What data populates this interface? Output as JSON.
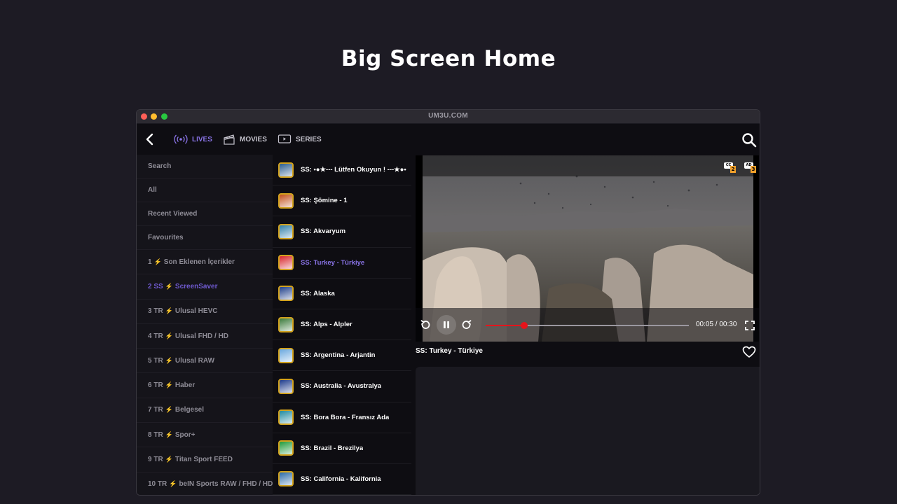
{
  "page": {
    "title": "Big Screen Home"
  },
  "window": {
    "url": "UM3U.COM"
  },
  "nav": {
    "lives": "LIVES",
    "movies": "MOVIES",
    "series": "SERIES"
  },
  "sidebar": {
    "items": [
      {
        "label": "Search"
      },
      {
        "label": "All"
      },
      {
        "label": "Recent Viewed"
      },
      {
        "label": "Favourites"
      }
    ],
    "categories": [
      {
        "num": "1",
        "prefix": "",
        "label": "Son Eklenen İçerikler"
      },
      {
        "num": "2 SS",
        "prefix": "",
        "label": "ScreenSaver"
      },
      {
        "num": "3 TR",
        "prefix": "",
        "label": "Ulusal HEVC"
      },
      {
        "num": "4 TR",
        "prefix": "",
        "label": "Ulusal FHD / HD"
      },
      {
        "num": "5 TR",
        "prefix": "",
        "label": "Ulusal RAW"
      },
      {
        "num": "6 TR",
        "prefix": "",
        "label": "Haber"
      },
      {
        "num": "7 TR",
        "prefix": "",
        "label": "Belgesel"
      },
      {
        "num": "8 TR",
        "prefix": "",
        "label": "Spor+"
      },
      {
        "num": "9 TR",
        "prefix": "",
        "label": "Titan Sport FEED"
      },
      {
        "num": "10 TR",
        "prefix": "",
        "label": "beIN Sports RAW / FHD / HD"
      }
    ]
  },
  "channels": [
    {
      "name": "SS: •●★--- Lütfen Okuyun ! ---★●•",
      "color": "#2b5d8f"
    },
    {
      "name": "SS: Şömine - 1",
      "color": "#c2501b"
    },
    {
      "name": "SS: Akvaryum",
      "color": "#2f7fa8"
    },
    {
      "name": "SS: Turkey - Türkiye",
      "color": "#d8252a"
    },
    {
      "name": "SS: Alaska",
      "color": "#1f3f8a"
    },
    {
      "name": "SS: Alps - Alpler",
      "color": "#3a7a3a"
    },
    {
      "name": "SS: Argentina - Arjantin",
      "color": "#6aa8de"
    },
    {
      "name": "SS: Australia - Avustralya",
      "color": "#1e3b8c"
    },
    {
      "name": "SS: Bora Bora - Fransız Ada",
      "color": "#1f8aa0"
    },
    {
      "name": "SS: Brazil - Brezilya",
      "color": "#1f9a3a"
    },
    {
      "name": "SS: California - Kalifornia",
      "color": "#2a6aa8"
    }
  ],
  "player": {
    "time": "00:05 / 00:30",
    "progress": 0.19,
    "cc_count": "2",
    "ad_count": "3",
    "cc_label": "CC",
    "ad_label": "AD"
  },
  "now_playing": {
    "title": "SS: Turkey - Türkiye"
  },
  "colors": {
    "accent": "#8a74e8",
    "progress": "#e5141b",
    "badge": "#f2a12b"
  }
}
